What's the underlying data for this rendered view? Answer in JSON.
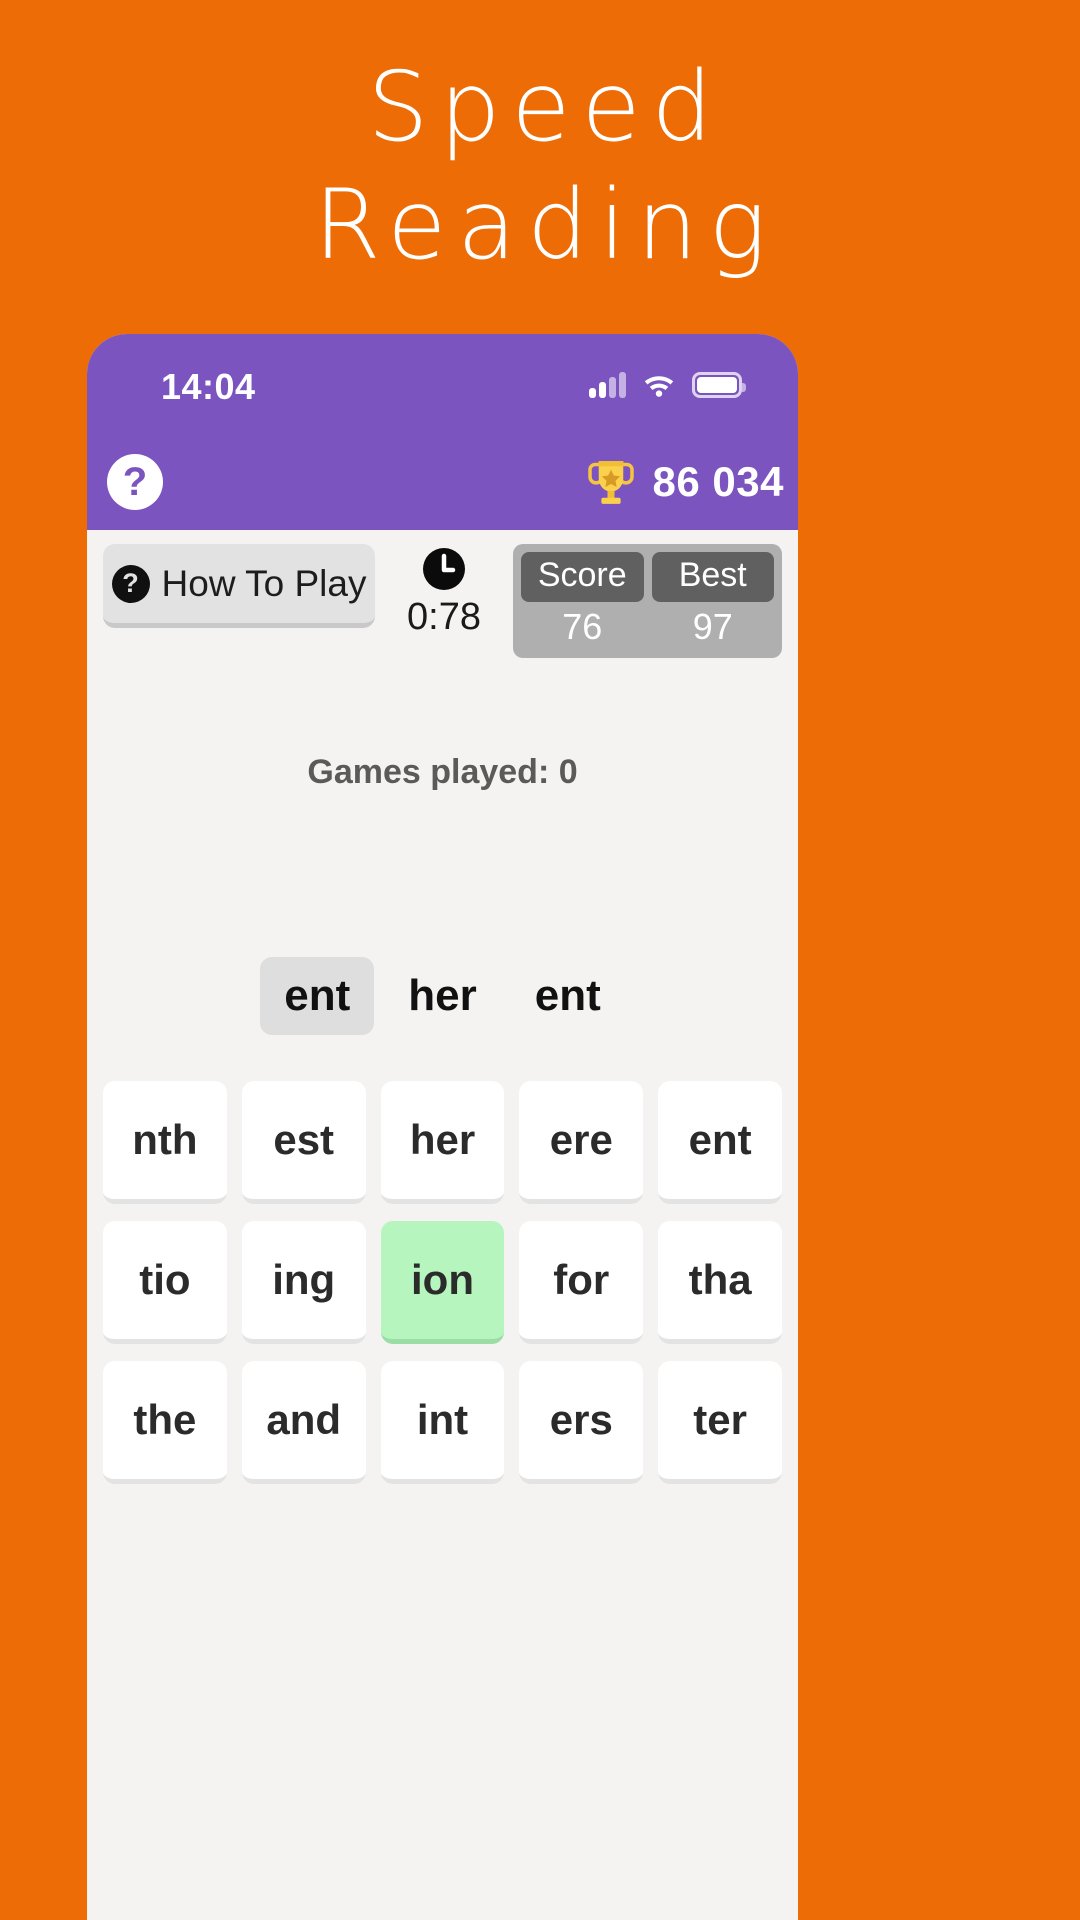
{
  "promo": {
    "background_color": "#ED6C05",
    "title_lines": [
      "Speed",
      "Reading"
    ]
  },
  "phone": {
    "status_bar": {
      "time": "14:04",
      "icons": [
        "signal-icon",
        "wifi-icon",
        "battery-icon"
      ],
      "background_color": "#7B54C0"
    },
    "app_header": {
      "help_button_label": "?",
      "trophy_icon": "trophy-icon",
      "total_score": "86 034"
    },
    "toolbar": {
      "how_to_play_label": "How To Play",
      "how_to_play_icon": "question-mark-icon",
      "clock_icon": "clock-icon",
      "timer": "0:78",
      "score_caption": "Score",
      "score_value": "76",
      "best_caption": "Best",
      "best_value": "97"
    },
    "stats": {
      "games_played": "Games played: 0"
    },
    "target_row": {
      "chips": [
        {
          "text": "ent",
          "active": true
        },
        {
          "text": "her",
          "active": false
        },
        {
          "text": "ent",
          "active": false
        }
      ]
    },
    "grid": {
      "correct_color": "#B6F5BE",
      "tiles": [
        {
          "text": "nth",
          "state": "default"
        },
        {
          "text": "est",
          "state": "default"
        },
        {
          "text": "her",
          "state": "default"
        },
        {
          "text": "ere",
          "state": "default"
        },
        {
          "text": "ent",
          "state": "default"
        },
        {
          "text": "tio",
          "state": "default"
        },
        {
          "text": "ing",
          "state": "default"
        },
        {
          "text": "ion",
          "state": "correct"
        },
        {
          "text": "for",
          "state": "default"
        },
        {
          "text": "tha",
          "state": "default"
        },
        {
          "text": "the",
          "state": "default"
        },
        {
          "text": "and",
          "state": "default"
        },
        {
          "text": "int",
          "state": "default"
        },
        {
          "text": "ers",
          "state": "default"
        },
        {
          "text": "ter",
          "state": "default"
        }
      ]
    }
  }
}
